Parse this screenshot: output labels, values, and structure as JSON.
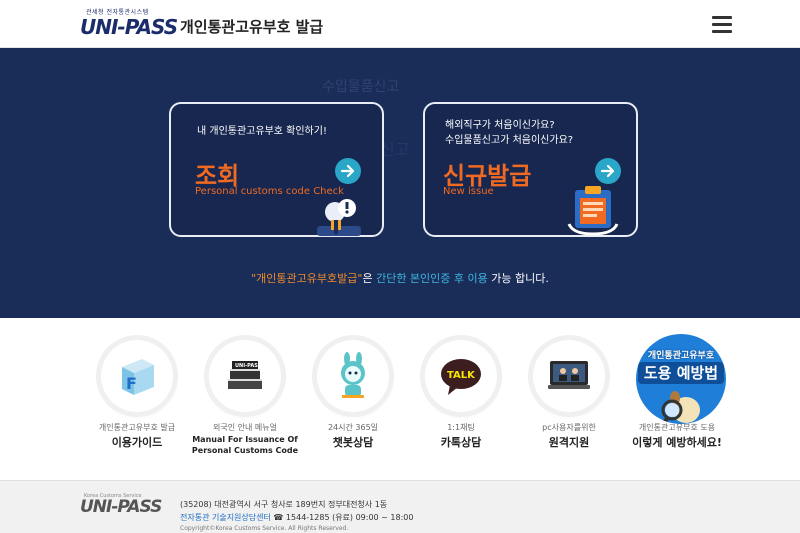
{
  "header": {
    "logo_sub": "관세청 전자통관시스템",
    "logo_text": "UNI-PASS",
    "title": "개인통관고유부호  발급"
  },
  "hero": {
    "ghost_text": "수입물품신고",
    "ghost_text2": "신고",
    "cards": [
      {
        "desc": "내 개인통관고유부호 확인하기!",
        "title": "조회",
        "subtitle": "Personal customs code Check"
      },
      {
        "desc_line1": "해외직구가 처음이신가요?",
        "desc_line2": "수입물품신고가 처음이신가요?",
        "title": "신규발급",
        "subtitle": "New issue"
      }
    ],
    "note": {
      "part1": "\"개인통관고유부호발급\"",
      "part2": "은 ",
      "part3": "간단한 본인인증 후 이용",
      "part4": " 가능 합니다."
    }
  },
  "services": [
    {
      "caption": "개인통관고유부호 발급",
      "label": "이용가이드",
      "icon": "guide-f-icon"
    },
    {
      "caption": "외국인 안내 메뉴얼",
      "label_line1": "Manual For Issuance Of",
      "label_line2": "Personal Customs Code",
      "icon": "manual-books-icon"
    },
    {
      "caption": "24시간 365일",
      "label": "챗봇상담",
      "icon": "chatbot-icon"
    },
    {
      "caption": "1:1채팅",
      "label": "카톡상담",
      "bubble_text": "TALK",
      "icon": "kakaotalk-icon"
    },
    {
      "caption": "pc사용자를위한",
      "label": "원격지원",
      "icon": "remote-support-icon"
    },
    {
      "caption": "개인통관고유부호 도용",
      "label": "이렇게 예방하세요!",
      "promo_top": "개인통관고유부호",
      "promo_main": "도용 예방법",
      "icon": "prevention-icon"
    }
  ],
  "footer": {
    "logo_text": "UNI-PASS",
    "logo_sub": "Korea Customs Service",
    "address": "(35208) 대전광역시 서구 청사로 189번지 정부대전청사 1동",
    "center_name": "전자통관 기술지원상담센터",
    "center_phone": "☎ 1544-1285 (유료) 09:00 ~ 18:00",
    "copyright": "Copyright©Korea Customs Service. All Rights Reserved."
  },
  "colors": {
    "hero_bg": "#1a2c58",
    "accent_orange": "#f06a22",
    "accent_cyan": "#2aa6c8",
    "brand_navy": "#1b2c6b"
  }
}
